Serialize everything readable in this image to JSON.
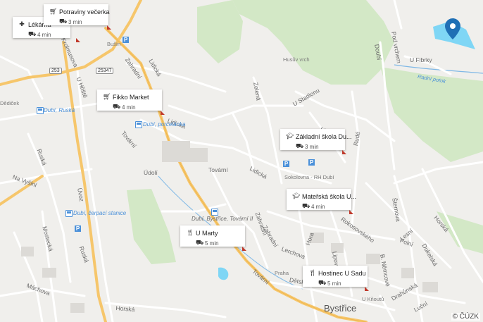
{
  "colors": {
    "map_bg": "#f0efec",
    "green": "#d3e8c6",
    "water": "#4a90d9",
    "lake": "#7fd6f5",
    "road_yellow": "#f6c66b",
    "marker": "#1f6fb5"
  },
  "street_labels": [
    "Krolmusova",
    "Ruská",
    "Na Vyšlní",
    "Úvoz",
    "Ruská",
    "Máchova",
    "Mostecká",
    "Horská",
    "Tovární",
    "Údolí",
    "Lidická",
    "Zahradní",
    "Lidická",
    "Zelená",
    "U Stadionu",
    "Zahradní",
    "Lidická",
    "Tovární",
    "Lidická",
    "Lerchova",
    "Rokosovského",
    "Lipová",
    "Zahradní",
    "Lesní",
    "Hora",
    "Doubí",
    "Pod vrchem",
    "U Fibrky",
    "Rudé",
    "Šternova",
    "Polní",
    "Dukelská",
    "B. Němcové",
    "Drahůnská",
    "Luční",
    "Horská",
    "Dětská",
    "Tovární",
    "U Hřiště"
  ],
  "stop_labels": [
    "Dubí, Ruská",
    "Dubí, porcelánka",
    "Dubí, čerpací stanice",
    "Dubí, Bystřice, Tovární II"
  ],
  "place_labels": [
    "Bušín",
    "Husův vrch",
    "Sokolovna - RH Dubí",
    "Praha",
    "U Kňoutů",
    "Dědiček"
  ],
  "water_labels": [
    "Radní potok"
  ],
  "town_label": "Bystřice",
  "road_shields": [
    "253",
    "25347",
    "25347"
  ],
  "pois": [
    {
      "category": "health-cross-icon",
      "name": "Lékárna",
      "time": "4 min"
    },
    {
      "category": "cart-icon",
      "name": "Potraviny večerka",
      "time": "3 min"
    },
    {
      "category": "cart-icon",
      "name": "Fikko Market",
      "time": "4 min"
    },
    {
      "category": "school-icon",
      "name": "Základní škola Du...",
      "time": "3 min"
    },
    {
      "category": "school-icon",
      "name": "Mateřská škola U...",
      "time": "4 min"
    },
    {
      "category": "restaurant-icon",
      "name": "U Marty",
      "time": "5 min"
    },
    {
      "category": "restaurant-icon",
      "name": "Hostinec U Sadu",
      "time": "5 min"
    }
  ],
  "travel_mode_icon": "car-icon",
  "marker_icon": "location-pin-icon",
  "parking_label": "P",
  "copyright": "© ČÚZK"
}
